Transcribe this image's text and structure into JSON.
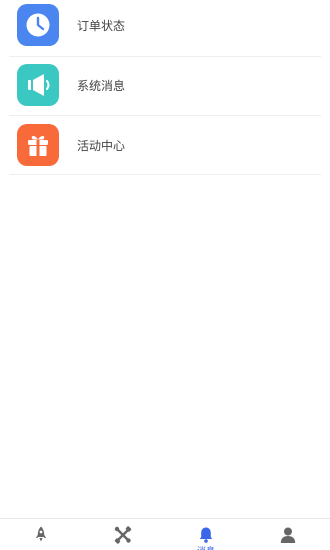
{
  "messages": {
    "items": [
      {
        "label": "订单状态",
        "icon": "clock-icon",
        "color": "#4a85f0"
      },
      {
        "label": "系统消息",
        "icon": "speaker-icon",
        "color": "#3cc8c2"
      },
      {
        "label": "活动中心",
        "icon": "gift-icon",
        "color": "#f96a3b"
      }
    ]
  },
  "tabbar": {
    "active_color": "#3a66e8",
    "inactive_color": "#666666",
    "tabs": [
      {
        "icon": "rocket-icon",
        "label": "",
        "active": false
      },
      {
        "icon": "tools-icon",
        "label": "",
        "active": false
      },
      {
        "icon": "bell-icon",
        "label": "消息",
        "active": true
      },
      {
        "icon": "user-icon",
        "label": "",
        "active": false
      }
    ]
  }
}
